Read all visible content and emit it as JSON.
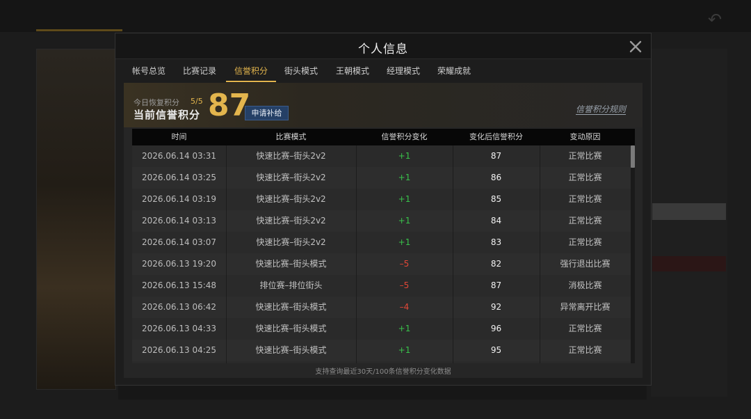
{
  "modal": {
    "title": "个人信息",
    "tabs": [
      {
        "label": "帐号总览",
        "active": false
      },
      {
        "label": "比赛记录",
        "active": false
      },
      {
        "label": "信誉积分",
        "active": true
      },
      {
        "label": "街头模式",
        "active": false
      },
      {
        "label": "王朝模式",
        "active": false
      },
      {
        "label": "经理模式",
        "active": false
      },
      {
        "label": "荣耀成就",
        "active": false
      }
    ]
  },
  "summary": {
    "recover_label": "今日恢复积分",
    "recover_count": "5/5",
    "current_label": "当前信誉积分",
    "current_score": "87",
    "apply_button": "申请补给",
    "rules_link": "信誉积分规则"
  },
  "table": {
    "headers": [
      "时间",
      "比赛模式",
      "信誉积分变化",
      "变化后信誉积分",
      "变动原因"
    ],
    "rows": [
      {
        "time": "2026.06.14  03:31",
        "mode": "快速比赛–街头2v2",
        "delta": "+1",
        "after": "87",
        "reason": "正常比赛"
      },
      {
        "time": "2026.06.14  03:25",
        "mode": "快速比赛–街头2v2",
        "delta": "+1",
        "after": "86",
        "reason": "正常比赛"
      },
      {
        "time": "2026.06.14  03:19",
        "mode": "快速比赛–街头2v2",
        "delta": "+1",
        "after": "85",
        "reason": "正常比赛"
      },
      {
        "time": "2026.06.14  03:13",
        "mode": "快速比赛–街头2v2",
        "delta": "+1",
        "after": "84",
        "reason": "正常比赛"
      },
      {
        "time": "2026.06.14  03:07",
        "mode": "快速比赛–街头2v2",
        "delta": "+1",
        "after": "83",
        "reason": "正常比赛"
      },
      {
        "time": "2026.06.13  19:20",
        "mode": "快速比赛–街头模式",
        "delta": "–5",
        "after": "82",
        "reason": "强行退出比赛"
      },
      {
        "time": "2026.06.13  15:48",
        "mode": "排位赛–排位街头",
        "delta": "–5",
        "after": "87",
        "reason": "消极比赛"
      },
      {
        "time": "2026.06.13  06:42",
        "mode": "快速比赛–街头模式",
        "delta": "–4",
        "after": "92",
        "reason": "异常离开比赛"
      },
      {
        "time": "2026.06.13  04:33",
        "mode": "快速比赛–街头模式",
        "delta": "+1",
        "after": "96",
        "reason": "正常比赛"
      },
      {
        "time": "2026.06.13  04:25",
        "mode": "快速比赛–街头模式",
        "delta": "+1",
        "after": "95",
        "reason": "正常比赛"
      }
    ],
    "footer_note": "支持查询最近30天/100条信誉积分变化数据"
  },
  "colors": {
    "accent_gold": "#e3b54d",
    "positive": "#39c24a",
    "negative": "#e24737",
    "apply_button_bg": "#254066"
  },
  "icons": {
    "close": "close-icon"
  }
}
